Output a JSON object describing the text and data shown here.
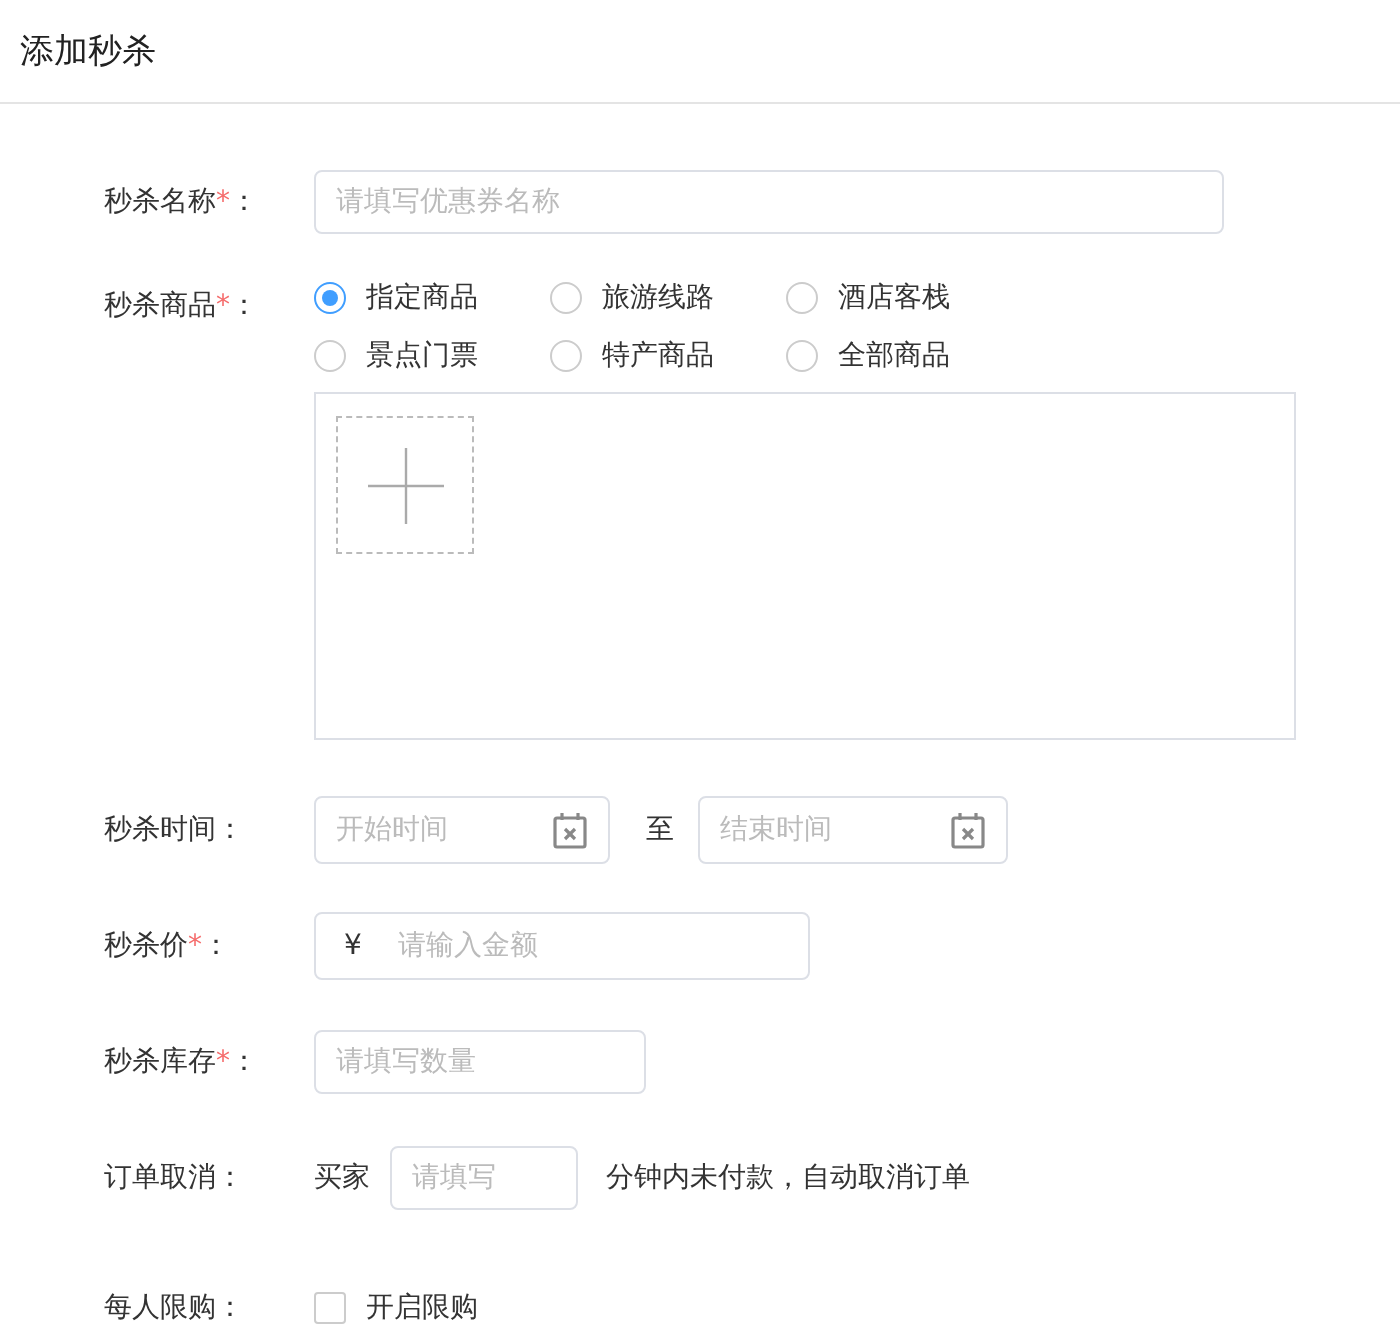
{
  "header": {
    "title": "添加秒杀"
  },
  "form": {
    "rows": [
      {
        "kind": "text",
        "label": "秒杀名称",
        "required_mark": "*",
        "colon": "：",
        "placeholder": "请填写优惠券名称"
      },
      {
        "kind": "radios",
        "label": "秒杀商品",
        "required_mark": "*",
        "colon": "：",
        "options": [
          {
            "label": "指定商品",
            "selected": true
          },
          {
            "label": "旅游线路",
            "selected": false
          },
          {
            "label": "酒店客栈",
            "selected": false
          },
          {
            "label": "景点门票",
            "selected": false
          },
          {
            "label": "特产商品",
            "selected": false
          },
          {
            "label": "全部商品",
            "selected": false
          }
        ]
      },
      {
        "kind": "upload"
      },
      {
        "kind": "daterange",
        "label": "秒杀时间",
        "colon": "：",
        "start_placeholder": "开始时间",
        "separator": "至",
        "end_placeholder": "结束时间"
      },
      {
        "kind": "money",
        "label": "秒杀价",
        "required_mark": "*",
        "colon": "：",
        "prefix": "¥",
        "placeholder": "请输入金额"
      },
      {
        "kind": "stock",
        "label": "秒杀库存",
        "required_mark": "*",
        "colon": "：",
        "placeholder": "请填写数量"
      },
      {
        "kind": "inline",
        "label": "订单取消",
        "colon": "：",
        "before": "买家",
        "placeholder": "请填写",
        "after": "分钟内未付款，自动取消订单"
      },
      {
        "kind": "checkbox",
        "label": "每人限购",
        "colon": "：",
        "option": "开启限购",
        "checked": false
      }
    ]
  }
}
